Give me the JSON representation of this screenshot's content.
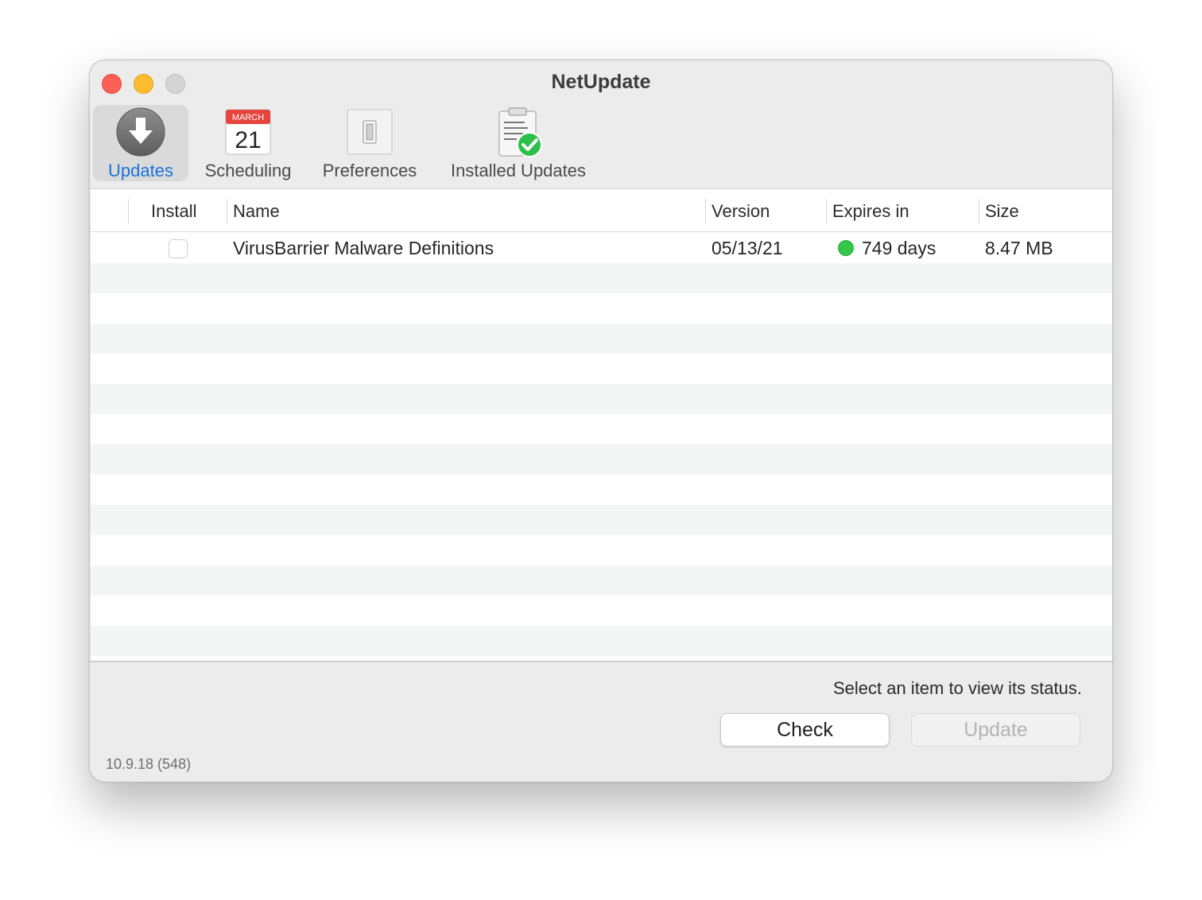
{
  "window": {
    "title": "NetUpdate"
  },
  "toolbar": {
    "items": [
      {
        "label": "Updates",
        "icon": "download-arrow-icon",
        "active": true
      },
      {
        "label": "Scheduling",
        "icon": "calendar-icon",
        "calendar_month": "MARCH",
        "calendar_day": "21"
      },
      {
        "label": "Preferences",
        "icon": "switch-icon"
      },
      {
        "label": "Installed Updates",
        "icon": "clipboard-check-icon"
      }
    ]
  },
  "table": {
    "columns": [
      "Install",
      "Name",
      "Version",
      "Expires in",
      "Size"
    ],
    "rows": [
      {
        "install": false,
        "name": "VirusBarrier Malware Definitions",
        "version": "05/13/21",
        "expires": "749 days",
        "expires_status_color": "#34c84a",
        "size": "8.47 MB"
      }
    ]
  },
  "footer": {
    "status_text": "Select an item to view its status.",
    "check_label": "Check",
    "update_label": "Update",
    "version": "10.9.18 (548)"
  }
}
